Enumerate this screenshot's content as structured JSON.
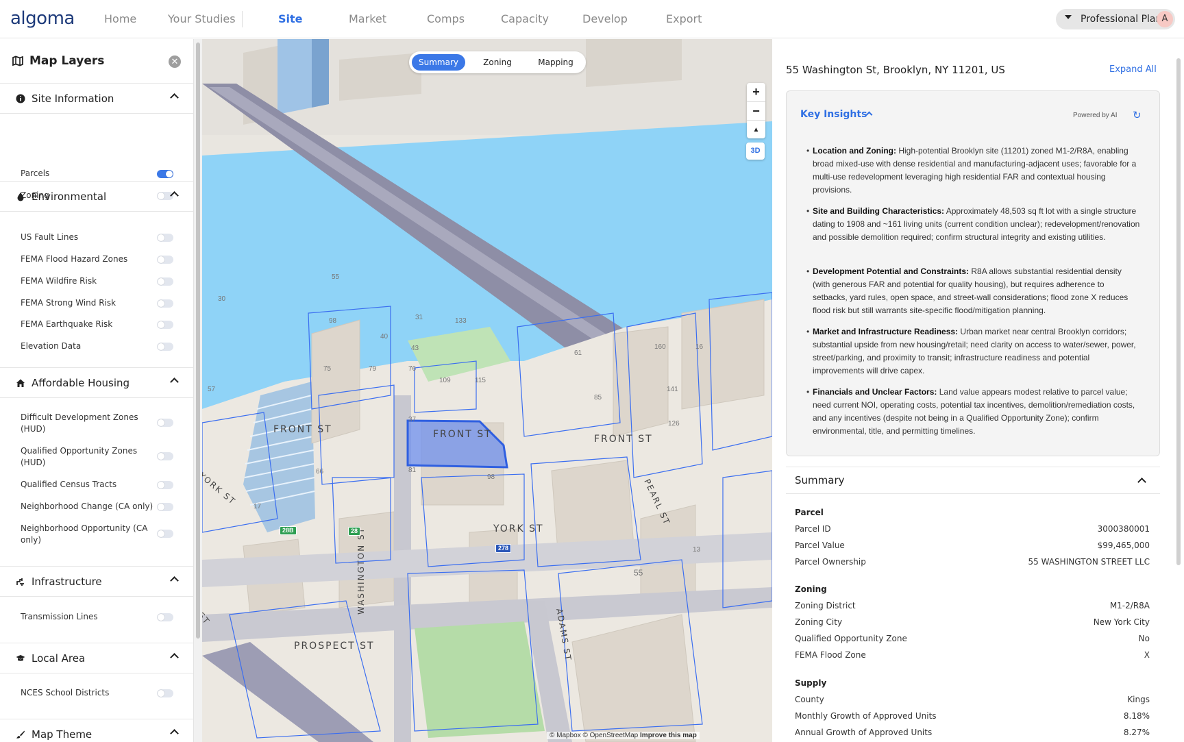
{
  "nav": {
    "logo": "algoma",
    "tabs": [
      "Home",
      "Your Studies",
      "Site",
      "Market",
      "Comps",
      "Capacity",
      "Develop",
      "Export"
    ],
    "active_tab": "Site",
    "plan_label": "Professional Plan",
    "avatar_initial": "A"
  },
  "sidebar": {
    "title": "Map Layers",
    "sections": [
      {
        "title": "Site Information",
        "icon": "info-icon",
        "layers": [
          {
            "label": "Parcels",
            "on": true
          },
          {
            "label": "Zoning",
            "on": false
          }
        ]
      },
      {
        "title": "Environmental",
        "icon": "drop-icon",
        "layers": [
          {
            "label": "US Fault Lines",
            "on": false
          },
          {
            "label": "FEMA Flood Hazard Zones",
            "on": false
          },
          {
            "label": "FEMA Wildfire Risk",
            "on": false
          },
          {
            "label": "FEMA Strong Wind Risk",
            "on": false
          },
          {
            "label": "FEMA Earthquake Risk",
            "on": false
          },
          {
            "label": "Elevation Data",
            "on": false
          }
        ]
      },
      {
        "title": "Affordable Housing",
        "icon": "home-icon",
        "layers": [
          {
            "label": "Difficult Development Zones (HUD)",
            "on": false
          },
          {
            "label": "Qualified Opportunity Zones (HUD)",
            "on": false
          },
          {
            "label": "Qualified Census Tracts",
            "on": false
          },
          {
            "label": "Neighborhood Change (CA only)",
            "on": false
          },
          {
            "label": "Neighborhood Opportunity (CA only)",
            "on": false
          }
        ]
      },
      {
        "title": "Infrastructure",
        "icon": "infrastructure-icon",
        "layers": [
          {
            "label": "Transmission Lines",
            "on": false
          }
        ]
      },
      {
        "title": "Local Area",
        "icon": "school-icon",
        "layers": [
          {
            "label": "NCES School Districts",
            "on": false
          }
        ]
      },
      {
        "title": "Map Theme",
        "icon": "brush-icon",
        "layers": []
      }
    ]
  },
  "map": {
    "view_tabs": [
      "Summary",
      "Zoning",
      "Mapping"
    ],
    "active_view": "Summary",
    "zoom_in": "+",
    "zoom_out": "−",
    "compass": "▲",
    "btn_3d": "3D",
    "attribution": "© Mapbox © OpenStreetMap",
    "improve": "Improve this map",
    "streets": [
      "FRONT ST",
      "FRONT ST",
      "FRONT ST",
      "YORK ST",
      "PROSPECT ST",
      "WASHINGTON ST",
      "ADAMS ST",
      "PEARL ST",
      "YORK ST",
      "ST"
    ],
    "lot_numbers": [
      "55",
      "30",
      "98",
      "31",
      "133",
      "40",
      "43",
      "75",
      "79",
      "76",
      "57",
      "109",
      "115",
      "61",
      "160",
      "16",
      "141",
      "85",
      "126",
      "37",
      "66",
      "81",
      "98",
      "17",
      "13",
      "55"
    ],
    "shields": [
      "28B",
      "28",
      "278"
    ]
  },
  "details": {
    "address": "55 Washington St, Brooklyn, NY 11201, US",
    "expand_all": "Expand All",
    "key_insights": {
      "title": "Key Insights",
      "powered_by": "Powered by AI",
      "items": [
        {
          "heading": "Location and Zoning:",
          "text": "High-potential Brooklyn site (11201) zoned M1-2/R8A, enabling broad mixed-use with dense residential and manufacturing-adjacent uses; favorable for a multi-use redevelopment leveraging high residential FAR and contextual housing provisions."
        },
        {
          "heading": "Site and Building Characteristics:",
          "text": "Approximately 48,503 sq ft lot with a single structure dating to 1908 and ~161 living units (current condition unclear); redevelopment/renovation and possible demolition required; confirm structural integrity and existing utilities."
        },
        {
          "heading": "Development Potential and Constraints:",
          "text": "R8A allows substantial residential density (with generous FAR and potential for quality housing), but requires adherence to setbacks, yard rules, open space, and street-wall considerations; flood zone X reduces flood risk but still warrants site-specific flood/mitigation planning."
        },
        {
          "heading": "Market and Infrastructure Readiness:",
          "text": "Urban market near central Brooklyn corridors; substantial upside from new housing/retail; need clarity on access to water/sewer, power, street/parking, and proximity to transit; infrastructure readiness and potential improvements will drive capex."
        },
        {
          "heading": "Financials and Unclear Factors:",
          "text": "Land value appears modest relative to parcel value; need current NOI, operating costs, potential tax incentives, demolition/remediation costs, and any incentives (despite not being in a Qualified Opportunity Zone); confirm environmental, title, and permitting timelines."
        }
      ]
    },
    "summary": {
      "title": "Summary",
      "groups": [
        {
          "name": "Parcel",
          "rows": [
            {
              "k": "Parcel ID",
              "v": "3000380001"
            },
            {
              "k": "Parcel Value",
              "v": "$99,465,000"
            },
            {
              "k": "Parcel Ownership",
              "v": "55 WASHINGTON STREET LLC"
            }
          ]
        },
        {
          "name": "Zoning",
          "rows": [
            {
              "k": "Zoning District",
              "v": "M1-2/R8A"
            },
            {
              "k": "Zoning City",
              "v": "New York City"
            },
            {
              "k": "Qualified Opportunity Zone",
              "v": "No"
            },
            {
              "k": "FEMA Flood Zone",
              "v": "X"
            }
          ]
        },
        {
          "name": "Supply",
          "rows": [
            {
              "k": "County",
              "v": "Kings"
            },
            {
              "k": "Monthly Growth of Approved Units",
              "v": "8.18%"
            },
            {
              "k": "Annual Growth of Approved Units",
              "v": "8.27%"
            }
          ]
        }
      ]
    }
  },
  "colors": {
    "accent": "#2f6fe3",
    "water": "#8fd3f7",
    "parcel_outline": "#3b6ef0",
    "selected_parcel": "#6f90ee"
  }
}
